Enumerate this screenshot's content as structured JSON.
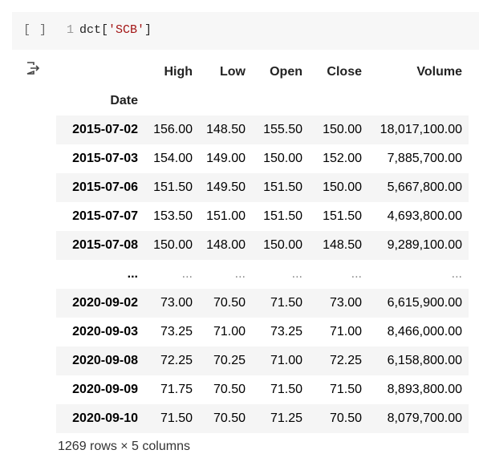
{
  "cell": {
    "run_indicator": "[ ]",
    "line_number": "1",
    "code_prefix": "dct[",
    "code_string": "'SCB'",
    "code_suffix": "]"
  },
  "output": {
    "icon": "output-arrow-icon",
    "columns": [
      "High",
      "Low",
      "Open",
      "Close",
      "Volume"
    ],
    "index_name": "Date",
    "rows": [
      {
        "date": "2015-07-02",
        "values": [
          "156.00",
          "148.50",
          "155.50",
          "150.00",
          "18,017,100.00"
        ]
      },
      {
        "date": "2015-07-03",
        "values": [
          "154.00",
          "149.00",
          "150.00",
          "152.00",
          "7,885,700.00"
        ]
      },
      {
        "date": "2015-07-06",
        "values": [
          "151.50",
          "149.50",
          "151.50",
          "150.00",
          "5,667,800.00"
        ]
      },
      {
        "date": "2015-07-07",
        "values": [
          "153.50",
          "151.00",
          "151.50",
          "151.50",
          "4,693,800.00"
        ]
      },
      {
        "date": "2015-07-08",
        "values": [
          "150.00",
          "148.00",
          "150.00",
          "148.50",
          "9,289,100.00"
        ]
      },
      {
        "date": "...",
        "values": [
          "...",
          "...",
          "...",
          "...",
          "..."
        ]
      },
      {
        "date": "2020-09-02",
        "values": [
          "73.00",
          "70.50",
          "71.50",
          "73.00",
          "6,615,900.00"
        ]
      },
      {
        "date": "2020-09-03",
        "values": [
          "73.25",
          "71.00",
          "73.25",
          "71.00",
          "8,466,000.00"
        ]
      },
      {
        "date": "2020-09-08",
        "values": [
          "72.25",
          "70.25",
          "71.00",
          "72.25",
          "6,158,800.00"
        ]
      },
      {
        "date": "2020-09-09",
        "values": [
          "71.75",
          "70.50",
          "71.50",
          "71.50",
          "8,893,800.00"
        ]
      },
      {
        "date": "2020-09-10",
        "values": [
          "71.50",
          "70.50",
          "71.25",
          "70.50",
          "8,079,700.00"
        ]
      }
    ],
    "summary": "1269 rows × 5 columns"
  }
}
